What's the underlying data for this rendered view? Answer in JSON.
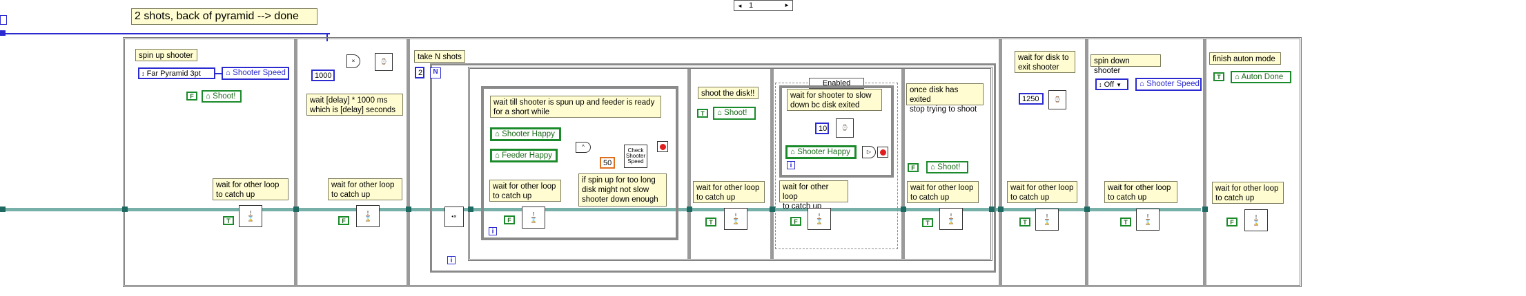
{
  "top_ring": {
    "value": "1",
    "left_arrow": "◄",
    "right_arrow": "►"
  },
  "title_note": "2 shots, back of pyramid --> done",
  "frames": {
    "f1": {
      "note": "spin up shooter",
      "enum_value": "Far Pyramid 3pt",
      "gvar": "Shooter Speed",
      "bool": "F",
      "bool_gvar": "Shoot!",
      "wait_note": "wait for other loop\nto catch up",
      "wait_bool": "T"
    },
    "f2": {
      "const_value": "1000",
      "delay_note": "wait [delay] * 1000 ms\nwhich is [delay] seconds",
      "wait_note": "wait for other loop\nto catch up",
      "wait_bool": "F"
    },
    "f3": {
      "note": "take N shots",
      "n_const": "2",
      "n_label": "N",
      "inner_note": "wait till shooter is spun up and feeder is ready\nfor a short while",
      "shooter_happy": "Shooter Happy",
      "feeder_happy": "Feeder Happy",
      "check_label": "Check\nShooter\nSpeed",
      "const_50": "50",
      "spin_note": "if spin up for too long\ndisk might not slow\nshooter down enough",
      "wait_note": "wait for other loop\nto catch up",
      "wait_bool": "F",
      "shoot_note": "shoot the disk!!",
      "shoot_bool": "T",
      "shoot_gvar": "Shoot!",
      "shoot_wait_note": "wait for other loop\nto catch up",
      "shoot_wait_bool": "T",
      "case_selector": "Enabled",
      "slow_note": "wait for shooter to slow\ndown bc disk exited",
      "const_10": "10",
      "shooter_happy2": "Shooter Happy",
      "case_wait_note": "wait for other loop\nto catch up",
      "case_wait_bool": "F",
      "exit_note": "once disk has exited\nstop trying to shoot",
      "exit_bool": "F",
      "exit_gvar": "Shoot!",
      "exit_wait_note": "wait for other loop\nto catch up",
      "exit_wait_bool": "T",
      "iter_label": "i"
    },
    "f4": {
      "note": "wait for disk to\nexit shooter",
      "const_value": "1250",
      "wait_note": "wait for other loop\nto catch up",
      "wait_bool": "T"
    },
    "f5": {
      "note": "spin down shooter",
      "enum_value": "Off",
      "gvar": "Shooter Speed",
      "wait_note": "wait for other loop\nto catch up",
      "wait_bool": "T"
    },
    "f6": {
      "note": "finish auton mode",
      "bool": "T",
      "gvar": "Auton Done",
      "wait_note": "wait for other loop\nto catch up",
      "wait_bool": "F"
    }
  },
  "colors": {
    "error_wire": "#76b0a8",
    "numeric_wire": "#2a2ad0",
    "boolean": "#1a8a2a",
    "note_bg": "#fefcd0"
  },
  "icons": [
    "global-variable-icon",
    "wait-ms-icon",
    "multiply-icon",
    "and-icon",
    "not-icon",
    "stop-icon",
    "iteration-icon",
    "compare-icon"
  ]
}
